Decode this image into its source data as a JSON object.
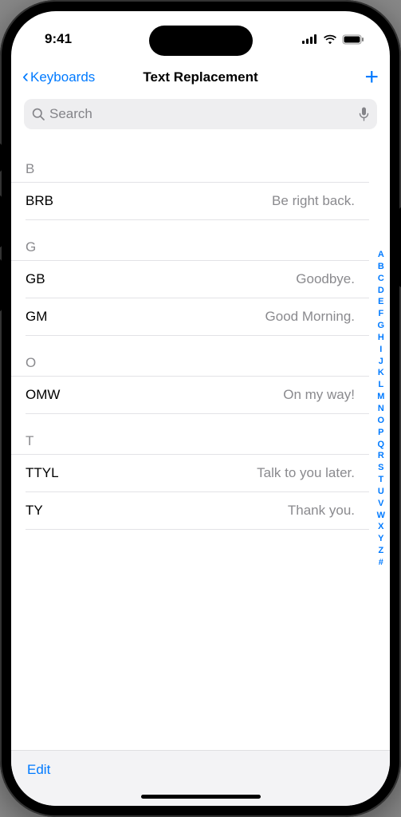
{
  "status": {
    "time": "9:41"
  },
  "nav": {
    "back": "Keyboards",
    "title": "Text Replacement"
  },
  "search": {
    "placeholder": "Search"
  },
  "index": [
    "A",
    "B",
    "C",
    "D",
    "E",
    "F",
    "G",
    "H",
    "I",
    "J",
    "K",
    "L",
    "M",
    "N",
    "O",
    "P",
    "Q",
    "R",
    "S",
    "T",
    "U",
    "V",
    "W",
    "X",
    "Y",
    "Z",
    "#"
  ],
  "sections": [
    {
      "letter": "B",
      "items": [
        {
          "shortcut": "BRB",
          "phrase": "Be right back."
        }
      ]
    },
    {
      "letter": "G",
      "items": [
        {
          "shortcut": "GB",
          "phrase": "Goodbye."
        },
        {
          "shortcut": "GM",
          "phrase": "Good Morning."
        }
      ]
    },
    {
      "letter": "O",
      "items": [
        {
          "shortcut": "OMW",
          "phrase": "On my way!"
        }
      ]
    },
    {
      "letter": "T",
      "items": [
        {
          "shortcut": "TTYL",
          "phrase": "Talk to you later."
        },
        {
          "shortcut": "TY",
          "phrase": "Thank you."
        }
      ]
    }
  ],
  "toolbar": {
    "edit": "Edit"
  }
}
